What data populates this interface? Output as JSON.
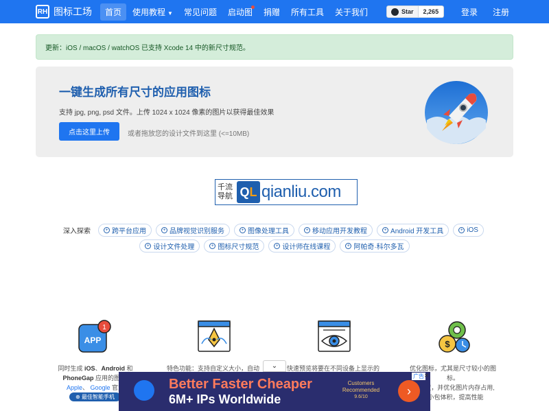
{
  "brand": {
    "logo_text": "RH",
    "name": "图标工场"
  },
  "nav": {
    "items": [
      {
        "label": "首页"
      },
      {
        "label": "使用教程"
      },
      {
        "label": "常见问题"
      },
      {
        "label": "启动图"
      },
      {
        "label": "捐赠"
      },
      {
        "label": "所有工具"
      },
      {
        "label": "关于我们"
      }
    ],
    "github_star_label": "Star",
    "github_star_count": "2,265",
    "login": "登录",
    "register": "注册"
  },
  "alert": {
    "text": "更新：iOS / macOS / watchOS 已支持 Xcode 14 中的新尺寸规范。"
  },
  "hero": {
    "title": "一键生成所有尺寸的应用图标",
    "description": "支持 jpg, png, psd 文件。上传 1024 x 1024 像素的图片以获得最佳效果",
    "upload_button": "点击这里上传",
    "drop_hint": "或者拖放您的设计文件到这里 (<=10MB)"
  },
  "ad_logo": {
    "cn_line1": "千流",
    "cn_line2": "导航",
    "ql_q": "Q",
    "ql_l": "L",
    "domain": "qianliu.com"
  },
  "explore": {
    "label": "深入探索",
    "row1": [
      "跨平台应用",
      "品牌视觉识别服务",
      "图像处理工具",
      "移动应用开发教程",
      "Android 开发工具",
      "iOS"
    ],
    "row2": [
      "设计文件处理",
      "图标尺寸规范",
      "设计师在线课程",
      "阿帕奇·科尔多瓦"
    ]
  },
  "features": {
    "app_badge_count": "1",
    "app_icon_text": "APP",
    "f1_line1_pre": "同时生成 ",
    "f1_ios": "iOS",
    "f1_sep": "、",
    "f1_android": "Android",
    "f1_and": " 和",
    "f1_phonegap": "PhoneGap",
    "f1_line2_post": " 应用的图标,",
    "f1_apple": "Apple",
    "f1_sep2": "、 ",
    "f1_google": "Google",
    "f1_line3_post": " 官方",
    "f1_badge": "最佳智能手机",
    "f2_text": "特色功能：支持自定义大小，自动调",
    "f3_text": "快速预览将要在不同设备上显示的应",
    "f4_line1": "优化图标，尤其是尺寸较小的图标。",
    "f4_line2": "度，并优化图片内存占用,",
    "f4_line3": "小包体积，提高性能"
  },
  "bottom_ad": {
    "headline": "Better Faster Cheaper",
    "subline": "6M+ IPs Worldwide",
    "badge_line1": "Customers",
    "badge_line2": "Recommended",
    "rating": "9.6/10",
    "ad_tag": "广告",
    "close": "✕",
    "toggle": "⌄",
    "arrow": "›"
  },
  "colors": {
    "primary": "#1f75f0",
    "brand_dark": "#1f5fae",
    "alert_bg": "#d4edda",
    "ad_bg": "#2a2d6e",
    "ad_accent": "#ff7b5c"
  }
}
